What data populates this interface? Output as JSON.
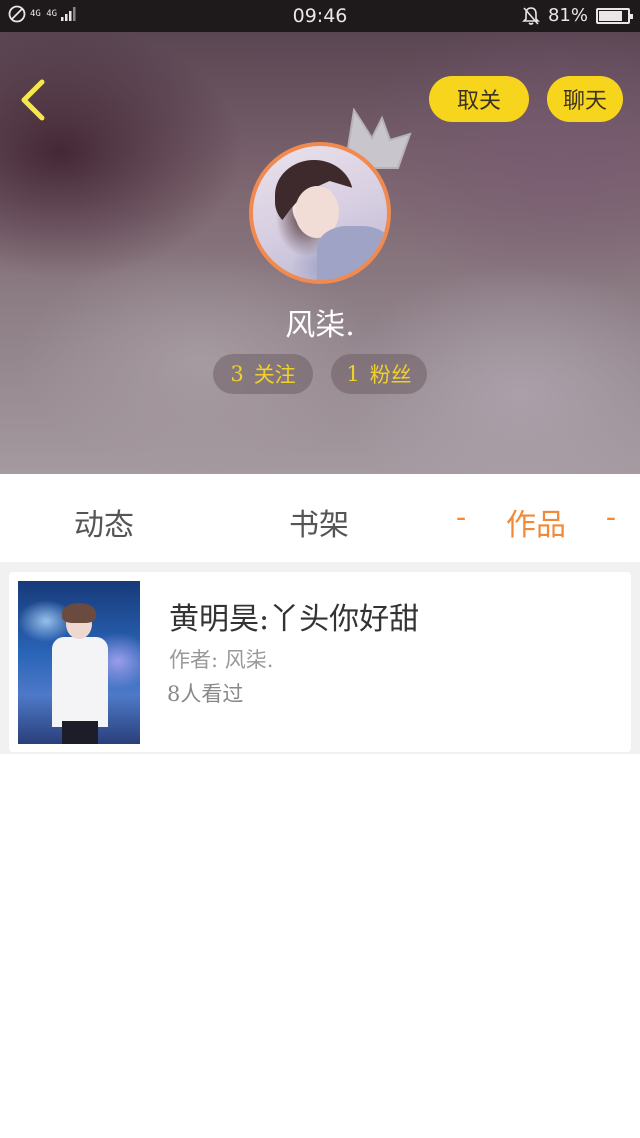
{
  "status_bar": {
    "network": "4G 4G",
    "time": "09:46",
    "battery_percent": "81%",
    "battery_level": 0.81,
    "icons": [
      "no-sim-icon",
      "signal-icon",
      "mute-bell-icon",
      "battery-icon"
    ]
  },
  "header": {
    "back_icon": "chevron-left-icon",
    "unfollow_label": "取关",
    "chat_label": "聊天",
    "username": "风柒.",
    "following": {
      "count": "3",
      "label": "关注"
    },
    "fans": {
      "count": "1",
      "label": "粉丝"
    }
  },
  "tabs": [
    {
      "label": "动态",
      "active": false
    },
    {
      "label": "书架",
      "active": false
    },
    {
      "label": "作品",
      "active": true,
      "marker": "-"
    }
  ],
  "works": [
    {
      "title": "黄明昊:丫头你好甜",
      "author": "作者: 风柒.",
      "views": "8人看过"
    }
  ],
  "colors": {
    "accent_yellow": "#f7d51c",
    "active_tab": "#f08a3a",
    "avatar_ring": "#f08a50",
    "stat_text": "#f2d02a"
  }
}
